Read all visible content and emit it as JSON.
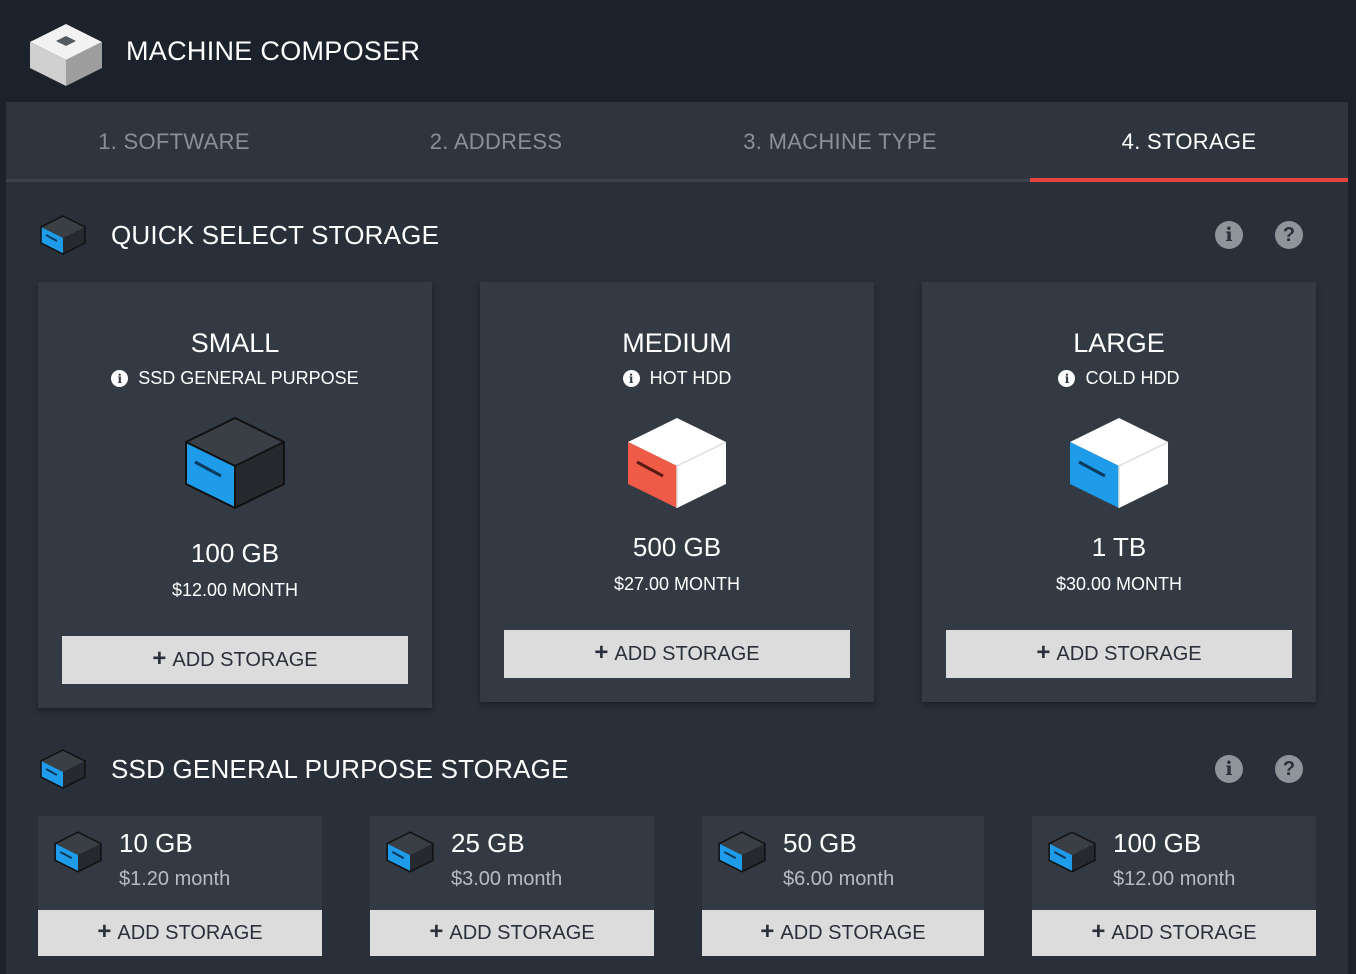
{
  "app": {
    "title": "MACHINE COMPOSER"
  },
  "tabs": [
    {
      "label": "1. SOFTWARE"
    },
    {
      "label": "2. ADDRESS"
    },
    {
      "label": "3. MACHINE TYPE"
    },
    {
      "label": "4. STORAGE"
    }
  ],
  "active_tab": "4. STORAGE",
  "quick_select": {
    "title": "QUICK SELECT STORAGE",
    "cards": [
      {
        "name": "SMALL",
        "type": "SSD GENERAL PURPOSE",
        "size": "100 GB",
        "price": "$12.00 MONTH",
        "button": "ADD STORAGE",
        "color": "#1e9be9"
      },
      {
        "name": "MEDIUM",
        "type": "HOT HDD",
        "size": "500 GB",
        "price": "$27.00 MONTH",
        "button": "ADD STORAGE",
        "color": "#ef5b46"
      },
      {
        "name": "LARGE",
        "type": "COLD HDD",
        "size": "1 TB",
        "price": "$30.00 MONTH",
        "button": "ADD STORAGE",
        "color": "#1e9be9"
      }
    ]
  },
  "ssd_general": {
    "title": "SSD GENERAL PURPOSE STORAGE",
    "items": [
      {
        "size": "10 GB",
        "price": "$1.20 month",
        "button": "ADD STORAGE"
      },
      {
        "size": "25 GB",
        "price": "$3.00 month",
        "button": "ADD STORAGE"
      },
      {
        "size": "50 GB",
        "price": "$6.00 month",
        "button": "ADD STORAGE"
      },
      {
        "size": "100 GB",
        "price": "$12.00 month",
        "button": "ADD STORAGE"
      }
    ]
  },
  "icons": {
    "info": "info-icon",
    "help": "help-icon",
    "plus": "plus-icon",
    "logo": "cube-logo-icon"
  },
  "colors": {
    "accent": "#e5453a",
    "ssd_blue": "#1e9be9",
    "hot_hdd_red": "#ef5b46",
    "background": "#2a3039",
    "card": "#333a43",
    "button": "#dcdcdc"
  }
}
